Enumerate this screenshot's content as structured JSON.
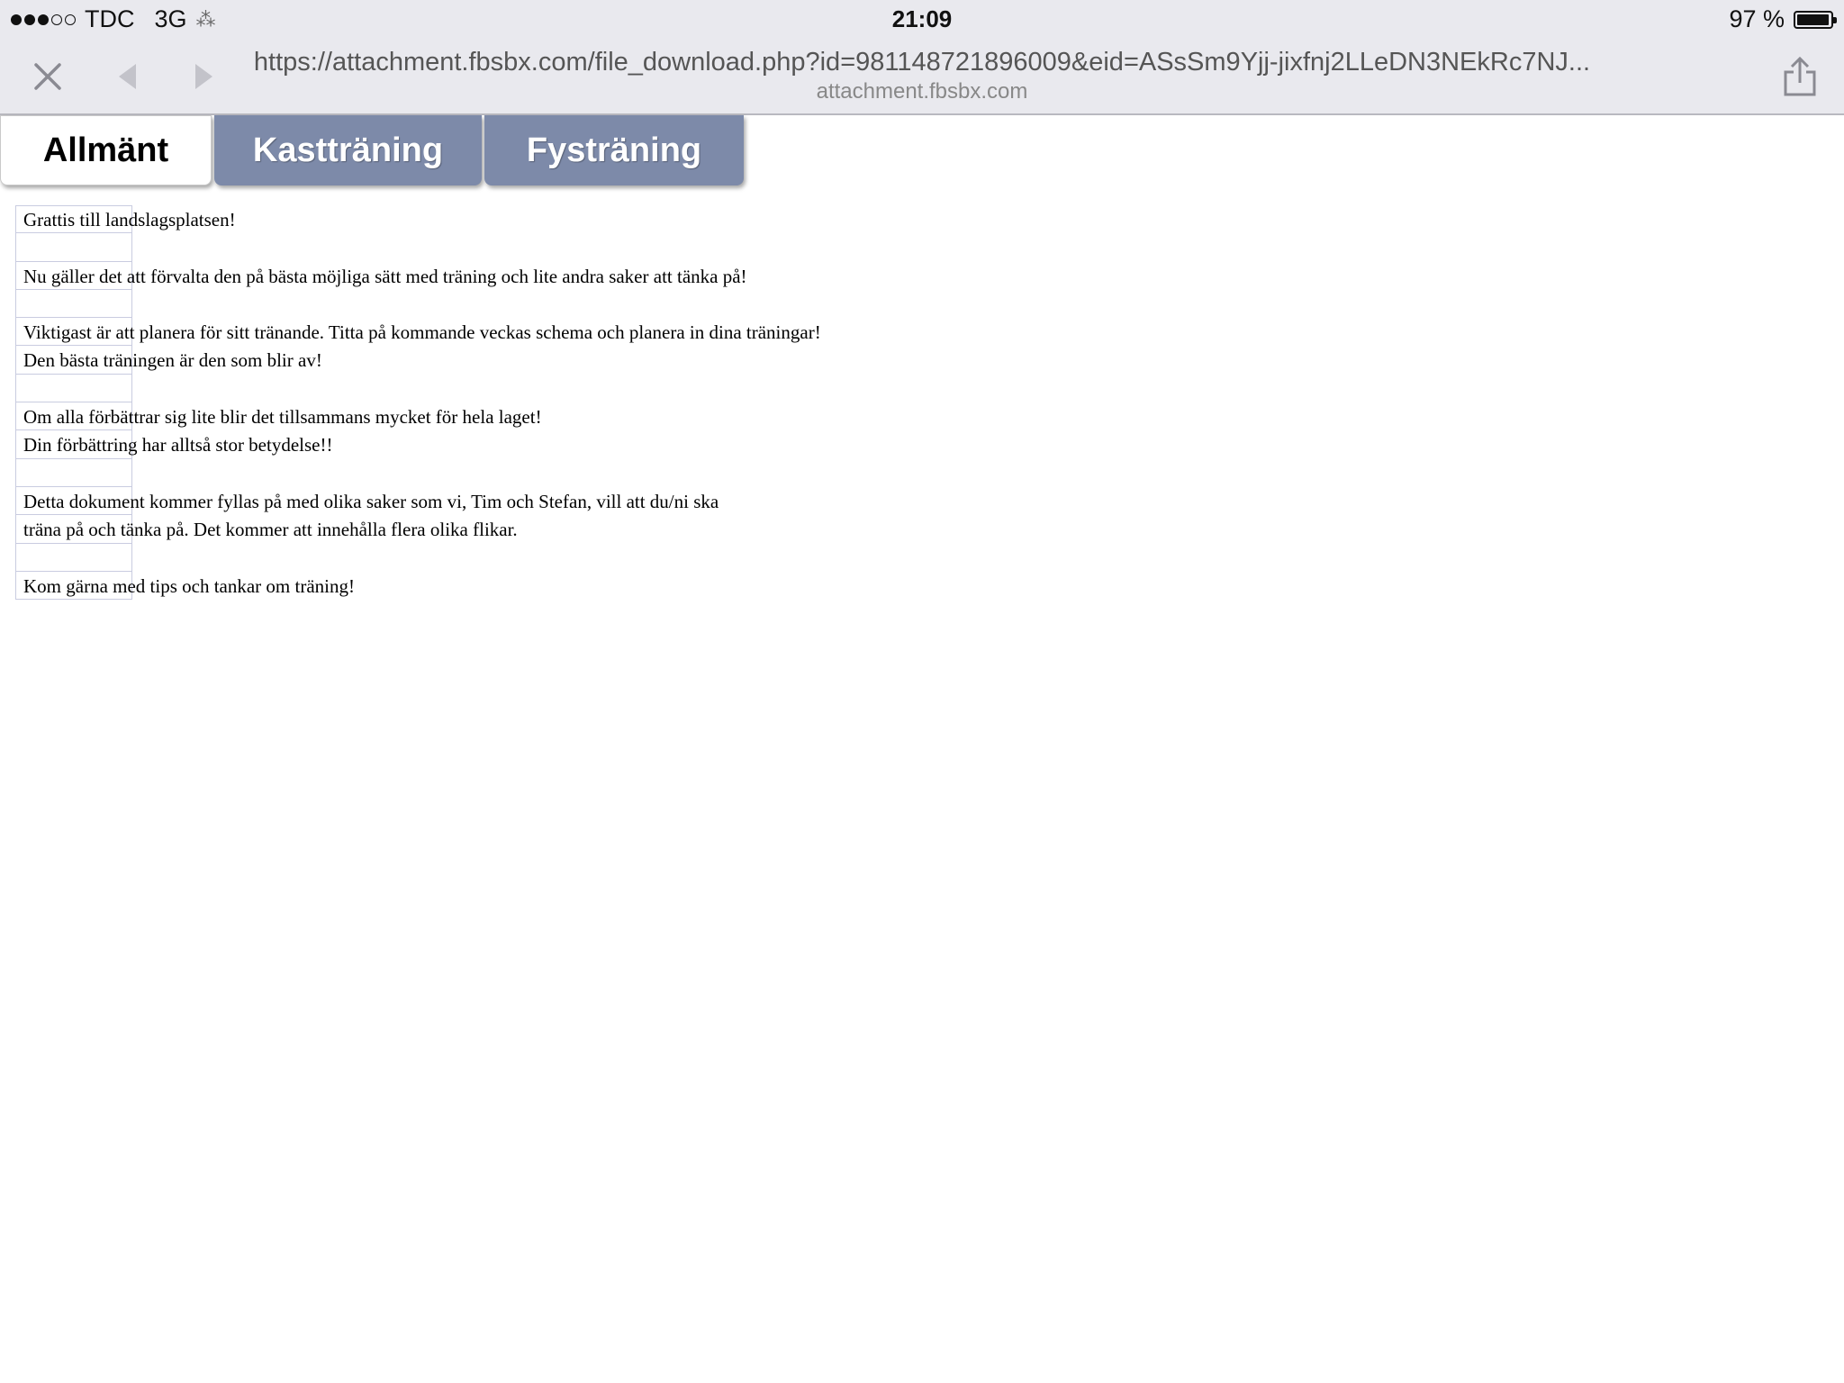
{
  "status_bar": {
    "carrier": "TDC",
    "network": "3G",
    "time": "21:09",
    "battery": "97 %",
    "battery_level": 0.97
  },
  "browser": {
    "url": "https://attachment.fbsbx.com/file_download.php?id=981148721896009&eid=ASsSm9Yjj-jixfnj2LLeDN3NEkRc7NJ...",
    "host": "attachment.fbsbx.com"
  },
  "tabs": [
    {
      "label": "Allmänt",
      "active": true
    },
    {
      "label": "Kastträning",
      "active": false
    },
    {
      "label": "Fysträning",
      "active": false
    }
  ],
  "sheet_rows": [
    "Grattis till landslagsplatsen!",
    "",
    "Nu gäller det att förvalta den på bästa möjliga sätt med träning och lite andra saker att tänka på!",
    "",
    "Viktigast är att planera för sitt tränande. Titta på kommande veckas schema och planera in dina träningar!",
    "Den bästa träningen är den som blir av!",
    "",
    "Om alla förbättrar sig lite blir det tillsammans mycket för hela laget!",
    "Din förbättring har alltså stor betydelse!!",
    "",
    "Detta dokument kommer fyllas på med olika saker som vi, Tim och Stefan, vill att du/ni ska",
    "träna på och tänka på. Det kommer att innehålla flera olika flikar.",
    "",
    "Kom gärna med tips och tankar om träning!"
  ]
}
